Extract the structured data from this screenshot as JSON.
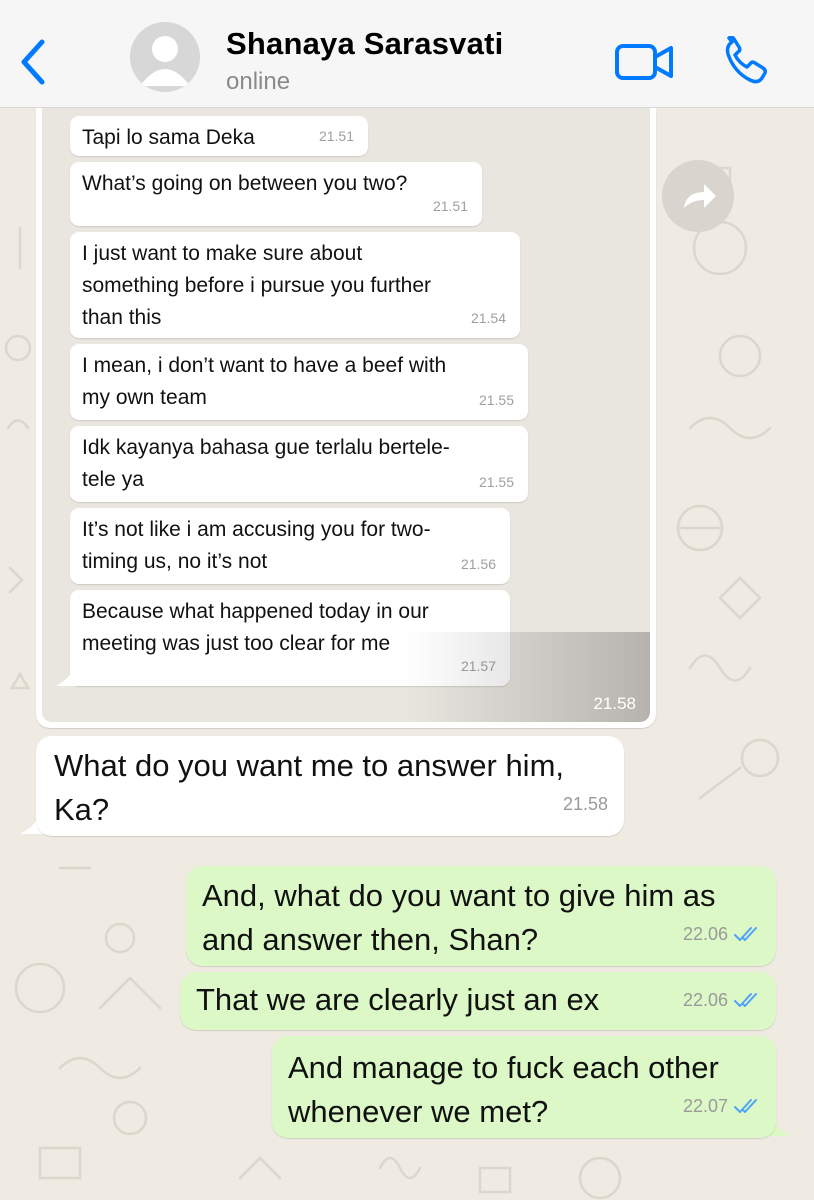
{
  "header": {
    "contact_name": "Shanaya Sarasvati",
    "status": "online",
    "back_icon": "chevron-left-icon",
    "video_icon": "video-camera-icon",
    "call_icon": "phone-icon",
    "accent_color": "#007aff"
  },
  "forwarded_screenshot": {
    "time": "21.58",
    "messages": [
      {
        "text_lines": [
          "Tapi lo sama Deka"
        ],
        "time": "21.51"
      },
      {
        "text_lines": [
          "What’s going on between you two?"
        ],
        "time": "21.51"
      },
      {
        "text_lines": [
          "I just want to make sure about",
          "something before i pursue you further",
          "than this"
        ],
        "time": "21.54"
      },
      {
        "text_lines": [
          "I mean, i don’t want to have a beef with",
          "my own team"
        ],
        "time": "21.55"
      },
      {
        "text_lines": [
          "Idk kayanya bahasa gue terlalu bertele-",
          "tele ya"
        ],
        "time": "21.55"
      },
      {
        "text_lines": [
          "It’s not like i am accusing you for two-",
          "timing us, no it’s not"
        ],
        "time": "21.56"
      },
      {
        "text_lines": [
          "Because what happened today in our",
          "meeting was just too clear for me"
        ],
        "time": "21.57"
      }
    ]
  },
  "messages": [
    {
      "direction": "in",
      "text_lines": [
        "What do you want me to answer him,",
        "Ka?"
      ],
      "time": "21.58"
    },
    {
      "direction": "out",
      "text_lines": [
        "And, what do you want to give him as",
        "and answer then, Shan?"
      ],
      "time": "22.06",
      "status": "read"
    },
    {
      "direction": "out",
      "text_lines": [
        "That we are clearly just an ex"
      ],
      "time": "22.06",
      "status": "read"
    },
    {
      "direction": "out",
      "text_lines": [
        "And manage to fuck each other",
        "whenever we met?"
      ],
      "time": "22.07",
      "status": "read"
    }
  ],
  "colors": {
    "incoming_bubble": "#ffffff",
    "outgoing_bubble": "#dcf8c6",
    "read_ticks": "#4fa3f7",
    "chat_background": "#efeae2"
  }
}
